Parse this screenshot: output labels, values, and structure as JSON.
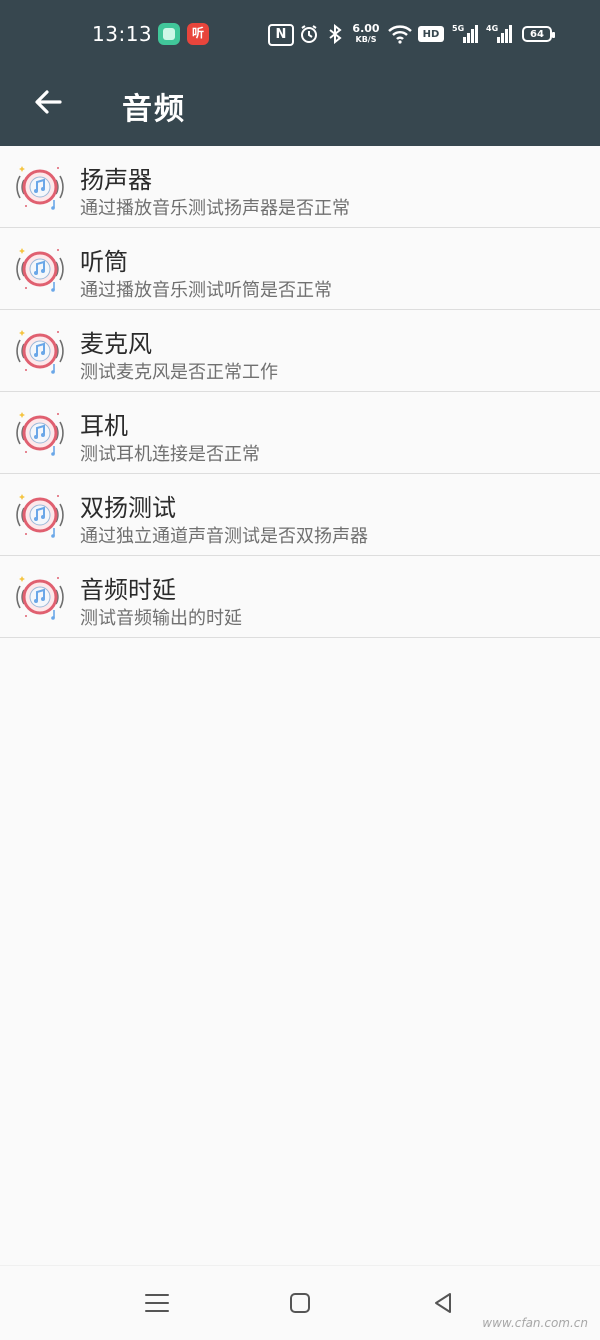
{
  "status_bar": {
    "time": "13:13",
    "red_app_glyph": "听",
    "nfc": "N",
    "net_speed_value": "6.00",
    "net_speed_unit": "KB/S",
    "hd_badge": "HD",
    "signal1": "5G",
    "signal2": "4G",
    "battery": "64"
  },
  "header": {
    "title": "音频",
    "back_icon": "arrow-left-icon",
    "bg_color": "#37474f"
  },
  "items": [
    {
      "label": "扬声器",
      "desc": "通过播放音乐测试扬声器是否正常",
      "icon": "audio-test-icon"
    },
    {
      "label": "听筒",
      "desc": "通过播放音乐测试听筒是否正常",
      "icon": "audio-test-icon"
    },
    {
      "label": "麦克风",
      "desc": "测试麦克风是否正常工作",
      "icon": "audio-test-icon"
    },
    {
      "label": "耳机",
      "desc": "测试耳机连接是否正常",
      "icon": "audio-test-icon"
    },
    {
      "label": "双扬测试",
      "desc": "通过独立通道声音测试是否双扬声器",
      "icon": "audio-test-icon"
    },
    {
      "label": "音频时延",
      "desc": "测试音频输出的时延",
      "icon": "audio-test-icon"
    }
  ],
  "nav": {
    "menu_icon": "menu-icon",
    "home_icon": "square-home-icon",
    "back_icon": "triangle-back-icon"
  },
  "watermark": "www.cfan.com.cn"
}
